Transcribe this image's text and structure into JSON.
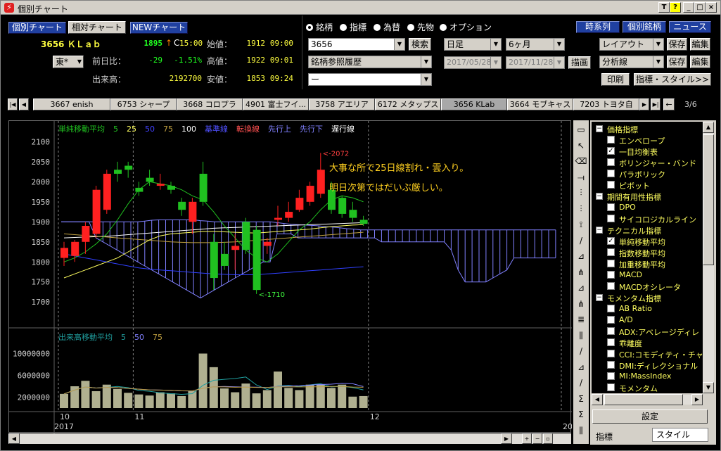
{
  "window": {
    "title": "個別チャート",
    "title_buttons": [
      "T",
      "?",
      "_",
      "□",
      "×"
    ]
  },
  "header": {
    "nav_buttons": [
      "個別チャート",
      "相対チャート",
      "NEWチャート"
    ],
    "stock_code_name": "3656 ＫＬａｂ",
    "price": "1895",
    "price_arrow": "↑",
    "price_tag": "C",
    "price_time": "15:00",
    "market": "東*",
    "labels": {
      "change": "前日比：",
      "volume": "出来高：",
      "open": "始値：",
      "high": "高値：",
      "low": "安値："
    },
    "change_value": "-29",
    "change_pct": "-1.51%",
    "volume_value": "2192700",
    "open_value": "1912",
    "open_time": "09:00",
    "high_value": "1922",
    "high_time": "09:01",
    "low_value": "1853",
    "low_time": "09:24",
    "radios": [
      {
        "label": "銘柄",
        "on": true
      },
      {
        "label": "指標",
        "on": false
      },
      {
        "label": "為替",
        "on": false
      },
      {
        "label": "先物",
        "on": false
      },
      {
        "label": "オプション",
        "on": false
      }
    ],
    "symbol_input": "3656",
    "search_button": "検索",
    "history_select": "銘柄参照履歴",
    "empty_select": "ー",
    "period_select": "日足",
    "range_select": "6ヶ月",
    "date_from": "2017/05/28",
    "date_to": "2017/11/28",
    "draw_button": "描画",
    "right_buttons": [
      "時系列",
      "個別銘柄",
      "ニュース"
    ],
    "layout_select": "レイアウト",
    "analysis_select": "分析線",
    "save_label": "保存",
    "edit_label": "編集",
    "print_button": "印刷",
    "indicator_style_button": "指標・スタイル>>"
  },
  "stock_tabs": {
    "items": [
      "3667 enish",
      "6753 シャープ",
      "3668 コロプラ",
      "4901 富士フイ...",
      "3758 アエリア",
      "6172 メタップス",
      "3656 KLab",
      "3664 モブキャス",
      "7203 トヨタ自"
    ],
    "active": 6,
    "page": "3/6"
  },
  "chart": {
    "legend": [
      {
        "text": "単純移動平均",
        "color": "#20c020"
      },
      {
        "text": "5",
        "color": "#20c020"
      },
      {
        "text": "25",
        "color": "#ffff60"
      },
      {
        "text": "50",
        "color": "#4040ff"
      },
      {
        "text": "75",
        "color": "#c0a040"
      },
      {
        "text": "100",
        "color": "#ffffff"
      },
      {
        "text": "基準線",
        "color": "#5050ff"
      },
      {
        "text": "転換線",
        "color": "#ff5050"
      },
      {
        "text": "先行上",
        "color": "#8080ff"
      },
      {
        "text": "先行下",
        "color": "#8080ff"
      },
      {
        "text": "遅行線",
        "color": "#ffffff"
      }
    ],
    "annotation_lines": [
      "大事な所で25日線割れ・雲入り。",
      "明日次第ではだいぶ厳しい。"
    ],
    "high_label": "<-2072",
    "low_label": "<-1710",
    "vol_legend": [
      {
        "text": "出来高移動平均",
        "color": "#20a0a0"
      },
      {
        "text": "5",
        "color": "#20a0a0"
      },
      {
        "text": "50",
        "color": "#8080ff"
      },
      {
        "text": "75",
        "color": "#c0a040"
      }
    ],
    "colors": {
      "up": "#ff2020",
      "down": "#20c020",
      "cloud": "#8080ff",
      "volume": "#b0b090"
    }
  },
  "chart_data": {
    "type": "candlestick",
    "price_axis": {
      "ticks": [
        2100,
        2050,
        2000,
        1950,
        1900,
        1850,
        1800,
        1750,
        1700
      ],
      "ylim": [
        1660,
        2120
      ]
    },
    "volume_axis": {
      "ticks": [
        "10000000",
        "6000000",
        "2000000"
      ],
      "ylim": [
        0,
        12000000
      ]
    },
    "x_labels": [
      {
        "text": "10",
        "i": 0
      },
      {
        "text": "11",
        "i": 7
      },
      {
        "text": "12",
        "i": 29
      }
    ],
    "year_label": "2017",
    "end_label": "20",
    "candles": [
      {
        "o": 1810,
        "h": 1850,
        "l": 1790,
        "c": 1835
      },
      {
        "o": 1815,
        "h": 1855,
        "l": 1800,
        "c": 1850
      },
      {
        "o": 1850,
        "h": 1900,
        "l": 1820,
        "c": 1890
      },
      {
        "o": 1870,
        "h": 1990,
        "l": 1860,
        "c": 1980
      },
      {
        "o": 1930,
        "h": 2030,
        "l": 1920,
        "c": 2020
      },
      {
        "o": 2030,
        "h": 2050,
        "l": 2000,
        "c": 2020
      },
      {
        "o": 2040,
        "h": 2050,
        "l": 2010,
        "c": 2030
      },
      {
        "o": 1985,
        "h": 2000,
        "l": 1965,
        "c": 1975
      },
      {
        "o": 2010,
        "h": 2030,
        "l": 1990,
        "c": 2000
      },
      {
        "o": 1990,
        "h": 2020,
        "l": 1980,
        "c": 1995
      },
      {
        "o": 1990,
        "h": 2000,
        "l": 1970,
        "c": 1980
      },
      {
        "o": 1950,
        "h": 1960,
        "l": 1915,
        "c": 1930
      },
      {
        "o": 1900,
        "h": 1960,
        "l": 1870,
        "c": 1950
      },
      {
        "o": 2020,
        "h": 2050,
        "l": 1940,
        "c": 1950
      },
      {
        "o": 1850,
        "h": 1870,
        "l": 1730,
        "c": 1760
      },
      {
        "o": 1820,
        "h": 1850,
        "l": 1780,
        "c": 1790
      },
      {
        "o": 1830,
        "h": 1870,
        "l": 1780,
        "c": 1840
      },
      {
        "o": 1900,
        "h": 1910,
        "l": 1820,
        "c": 1830
      },
      {
        "o": 1880,
        "h": 1890,
        "l": 1720,
        "c": 1730
      },
      {
        "o": 1840,
        "h": 1860,
        "l": 1820,
        "c": 1850
      },
      {
        "o": 1905,
        "h": 1940,
        "l": 1890,
        "c": 1910
      },
      {
        "o": 1910,
        "h": 1950,
        "l": 1900,
        "c": 1925
      },
      {
        "o": 1930,
        "h": 1980,
        "l": 1925,
        "c": 1960
      },
      {
        "o": 1950,
        "h": 2000,
        "l": 1940,
        "c": 1990
      },
      {
        "o": 1970,
        "h": 2072,
        "l": 1960,
        "c": 2030
      },
      {
        "o": 1980,
        "h": 2000,
        "l": 1920,
        "c": 1930
      },
      {
        "o": 1960,
        "h": 1965,
        "l": 1910,
        "c": 1920
      },
      {
        "o": 1930,
        "h": 1950,
        "l": 1900,
        "c": 1910
      },
      {
        "o": 1905,
        "h": 1915,
        "l": 1890,
        "c": 1895
      }
    ],
    "volumes": [
      2600000,
      4000000,
      5000000,
      3100000,
      4300000,
      3500000,
      2800000,
      2500000,
      2300000,
      2900000,
      2700000,
      2200000,
      3100000,
      10000000,
      7500000,
      3600000,
      2900000,
      4500000,
      2700000,
      3300000,
      6700000,
      3700000,
      3300000,
      4300000,
      4400000,
      3700000,
      4300000,
      2100000,
      2200000
    ],
    "ma5": [
      1800,
      1810,
      1825,
      1845,
      1870,
      1905,
      1945,
      1980,
      2000,
      1995,
      1990,
      1980,
      1965,
      1955,
      1925,
      1890,
      1860,
      1830,
      1810,
      1800,
      1820,
      1850,
      1880,
      1900,
      1930,
      1955,
      1965,
      1960,
      1950
    ],
    "ma25": [
      1760,
      1770,
      1780,
      1790,
      1800,
      1810,
      1825,
      1840,
      1855,
      1865,
      1870,
      1872,
      1874,
      1876,
      1876,
      1875,
      1874,
      1873,
      1872,
      1874,
      1876,
      1878,
      1880,
      1882,
      1885,
      1888,
      1890,
      1892,
      1893
    ],
    "ma50": [
      1820,
      1815,
      1810,
      1805,
      1800,
      1795,
      1790,
      1785,
      1782,
      1780,
      1778,
      1776,
      1774,
      1772,
      1770,
      1769,
      1768,
      1768,
      1768,
      1770,
      1772,
      1774,
      1776,
      1778,
      1780,
      1782,
      1784,
      1786,
      1788
    ],
    "ma75": [
      1870,
      1868,
      1866,
      1864,
      1862,
      1860,
      1858,
      1856,
      1854,
      1852,
      1850,
      1849,
      1848,
      1848,
      1848,
      1849,
      1850,
      1852,
      1854,
      1856,
      1858,
      1860,
      1862,
      1864,
      1866,
      1868,
      1870,
      1872,
      1874
    ],
    "ma100": [
      1860,
      1861,
      1862,
      1863,
      1864,
      1866,
      1868,
      1870,
      1872,
      1874,
      1876,
      1878,
      1880,
      1882,
      1884,
      1885,
      1886,
      1887,
      1888,
      1889,
      1890,
      1891,
      1892,
      1893,
      1894,
      1895,
      1896,
      1897,
      1898
    ],
    "cloud_top": [
      1900,
      1900,
      1900,
      1900,
      1900,
      1900,
      1900,
      1900,
      1900,
      1900,
      1900,
      1900,
      1902,
      1904,
      1905,
      1905,
      1905,
      1905,
      1905,
      1905,
      1903,
      1902,
      1900,
      1900,
      1900,
      1900,
      1900,
      1900,
      1900,
      1900,
      1900,
      1898,
      1896,
      1894,
      1893,
      1892,
      1891,
      1890,
      1888,
      1887,
      1885,
      1883,
      1882,
      1880,
      1880,
      1880,
      1880,
      1880,
      1880,
      1880,
      1880,
      1880,
      1880,
      1880,
      1880,
      1880,
      1880,
      1880,
      1880,
      1880,
      1880,
      1880,
      1880,
      1880,
      1880,
      1880,
      1880,
      1880,
      1880,
      1880,
      1880,
      1880
    ],
    "cloud_bot": [
      1900,
      1900,
      1900,
      1900,
      1900,
      1860,
      1850,
      1840,
      1830,
      1820,
      1810,
      1800,
      1790,
      1780,
      1770,
      1760,
      1750,
      1740,
      1730,
      1720,
      1710,
      1720,
      1730,
      1740,
      1750,
      1760,
      1770,
      1780,
      1790,
      1800,
      1800,
      1870,
      1870,
      1870,
      1860,
      1860,
      1860,
      1860,
      1860,
      1860,
      1860,
      1860,
      1860,
      1860,
      1860,
      1860,
      1850,
      1850,
      1850,
      1850,
      1850,
      1850,
      1850,
      1850,
      1850,
      1850,
      1830,
      1780,
      1750,
      1750,
      1750,
      1750,
      1760,
      1770,
      1780,
      1810,
      1810,
      1810,
      1810,
      1810,
      1810,
      1810
    ]
  },
  "tools": [
    "▭",
    "↖",
    "⌫",
    "⟞",
    "⫶",
    "⫶",
    "⟟",
    "/",
    "⊿",
    "⋔",
    "⊿",
    "⋔",
    "≣",
    "⫼",
    "/",
    "⊿",
    "/",
    "Σ",
    "Σ",
    "⫼"
  ],
  "right_panel": {
    "tree": [
      {
        "text": "価格指標",
        "cat": true,
        "open": true
      },
      {
        "text": "エンベロープ",
        "checked": false
      },
      {
        "text": "一目均衡表",
        "checked": true
      },
      {
        "text": "ボリンジャー・バンド",
        "checked": false
      },
      {
        "text": "パラボリック",
        "checked": false
      },
      {
        "text": "ピボット",
        "checked": false
      },
      {
        "text": "期間有用性指標",
        "cat": true,
        "open": true
      },
      {
        "text": "DPO",
        "checked": false
      },
      {
        "text": "サイコロジカルライン",
        "checked": false
      },
      {
        "text": "テクニカル指標",
        "cat": true,
        "open": true
      },
      {
        "text": "単純移動平均",
        "checked": true
      },
      {
        "text": "指数移動平均",
        "checked": false
      },
      {
        "text": "加重移動平均",
        "checked": false
      },
      {
        "text": "MACD",
        "checked": false
      },
      {
        "text": "MACDオシレータ",
        "checked": false
      },
      {
        "text": "モメンタム指標",
        "cat": true,
        "open": true
      },
      {
        "text": "AB Ratio",
        "checked": false
      },
      {
        "text": "A/D",
        "checked": false
      },
      {
        "text": "ADX:アベレージディレ",
        "checked": false
      },
      {
        "text": "乖離度",
        "checked": false
      },
      {
        "text": "CCI:コモディティ・チャ",
        "checked": false
      },
      {
        "text": "DMI:ディレクショナル",
        "checked": false
      },
      {
        "text": "MI:MassIndex",
        "checked": false
      },
      {
        "text": "モメンタム",
        "checked": false
      }
    ],
    "settings_button": "設定",
    "tabs": [
      "指標",
      "スタイル"
    ]
  }
}
